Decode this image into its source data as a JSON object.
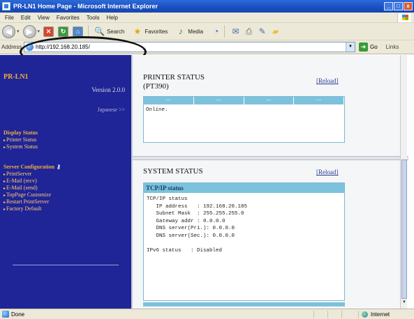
{
  "window": {
    "title": "PR-LN1 Home Page - Microsoft Internet Explorer",
    "buttons": [
      "_",
      "□",
      "x"
    ]
  },
  "menu": [
    "File",
    "Edit",
    "View",
    "Favorites",
    "Tools",
    "Help"
  ],
  "toolbar": {
    "back_label": "Back",
    "search_label": "Search",
    "favorites_label": "Favorites",
    "media_label": "Media"
  },
  "address": {
    "label": "Address",
    "value": "http://192.168.20.185/",
    "go_label": "Go",
    "links_label": "Links"
  },
  "sidebar": {
    "logo": "PR-LN1",
    "version": "Version 2.0.0",
    "japanese": "Japanese >>",
    "display_status": {
      "heading": "Display Status",
      "items": [
        "Printer Status",
        "System Status"
      ]
    },
    "server_configuration": {
      "heading": "Server Configuration",
      "items": [
        "PrintServer",
        "E-Mail (recv)",
        "E-Mail (send)",
        "TopPage Customize",
        "Restart PrintServer",
        "Factory Default"
      ]
    }
  },
  "printer_status": {
    "title": "PRINTER STATUS",
    "model": "(PT390)",
    "reload": "[Reload]",
    "columns": [
      "---",
      "---",
      "---",
      "---"
    ],
    "message": "Online."
  },
  "system_status": {
    "title": "SYSTEM STATUS",
    "reload": "[Reload]",
    "section": "TCP/IP status",
    "body": "TCP/IP status\n   IP address   : 192.168.20.185\n   Subnet Mask  : 255.255.255.0\n   Gateway addr : 0.0.0.0\n   DNS server(Pri.): 0.0.0.0\n   DNS server(Sec.): 0.0.0.0\n\nIPv6 status   : Disabled"
  },
  "statusbar": {
    "left": "Done",
    "zone": "Internet"
  }
}
